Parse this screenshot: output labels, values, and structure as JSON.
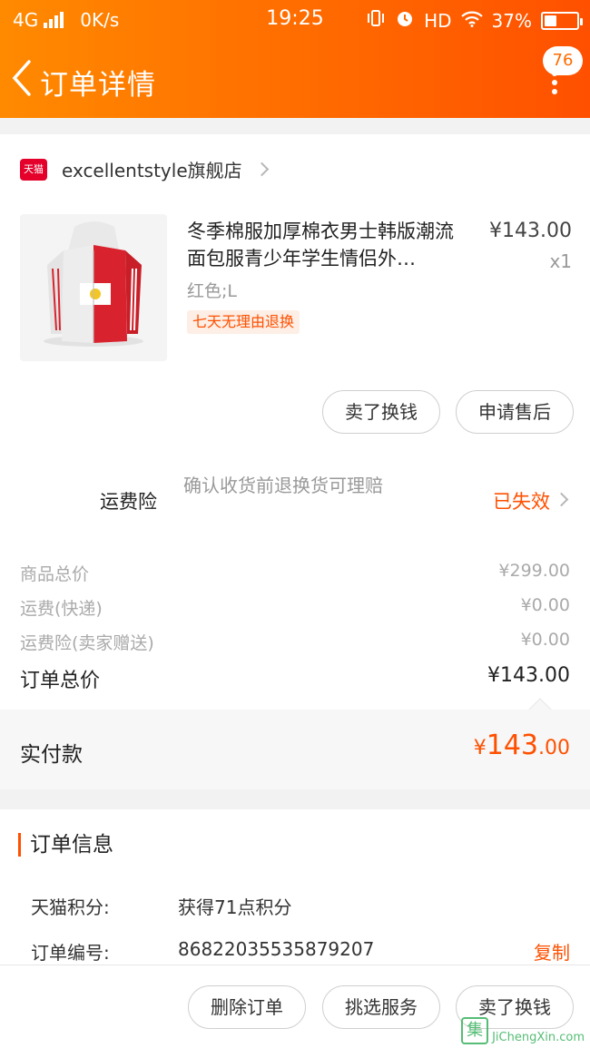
{
  "status": {
    "network": "4G",
    "speed": "0K/s",
    "time": "19:25",
    "hd": "HD",
    "battery": "37%",
    "battery_level": 0.37
  },
  "nav": {
    "title": "订单详情",
    "badge": "76"
  },
  "store": {
    "logo_text": "天猫",
    "name": "excellentstyle旗舰店"
  },
  "product": {
    "title": "冬季棉服加厚棉衣男士韩版潮流面包服青少年学生情侣外…",
    "price": "¥143.00",
    "qty": "x1",
    "sku": "红色;L",
    "tag": "七天无理由退换"
  },
  "item_actions": {
    "sell": "卖了换钱",
    "aftersale": "申请售后"
  },
  "insurance": {
    "label": "运费险",
    "desc": "确认收货前退换货可理赔",
    "status": "已失效"
  },
  "costs": [
    {
      "label": "商品总价",
      "value": "¥299.00"
    },
    {
      "label": "运费(快递)",
      "value": "¥0.00"
    },
    {
      "label": "运费险(卖家赠送)",
      "value": "¥0.00"
    }
  ],
  "order_total": {
    "label": "订单总价",
    "value": "¥143.00"
  },
  "paid": {
    "label": "实付款",
    "currency": "¥",
    "integer": "143",
    "decimal": ".00"
  },
  "order_info": {
    "title": "订单信息",
    "points_label": "天猫积分:",
    "points_value": "获得71点积分",
    "order_no_label": "订单编号:",
    "order_no_value": "86822035535879207",
    "copy": "复制"
  },
  "bottom_actions": {
    "delete": "删除订单",
    "service": "挑选服务",
    "sell": "卖了换钱"
  },
  "watermark": {
    "glyph": "集",
    "text": "JiChengXin.com"
  },
  "colors": {
    "brand": "#ff5000",
    "header_start": "#ff8a00",
    "header_end": "#ff5000",
    "tmall_red": "#e4002b"
  }
}
